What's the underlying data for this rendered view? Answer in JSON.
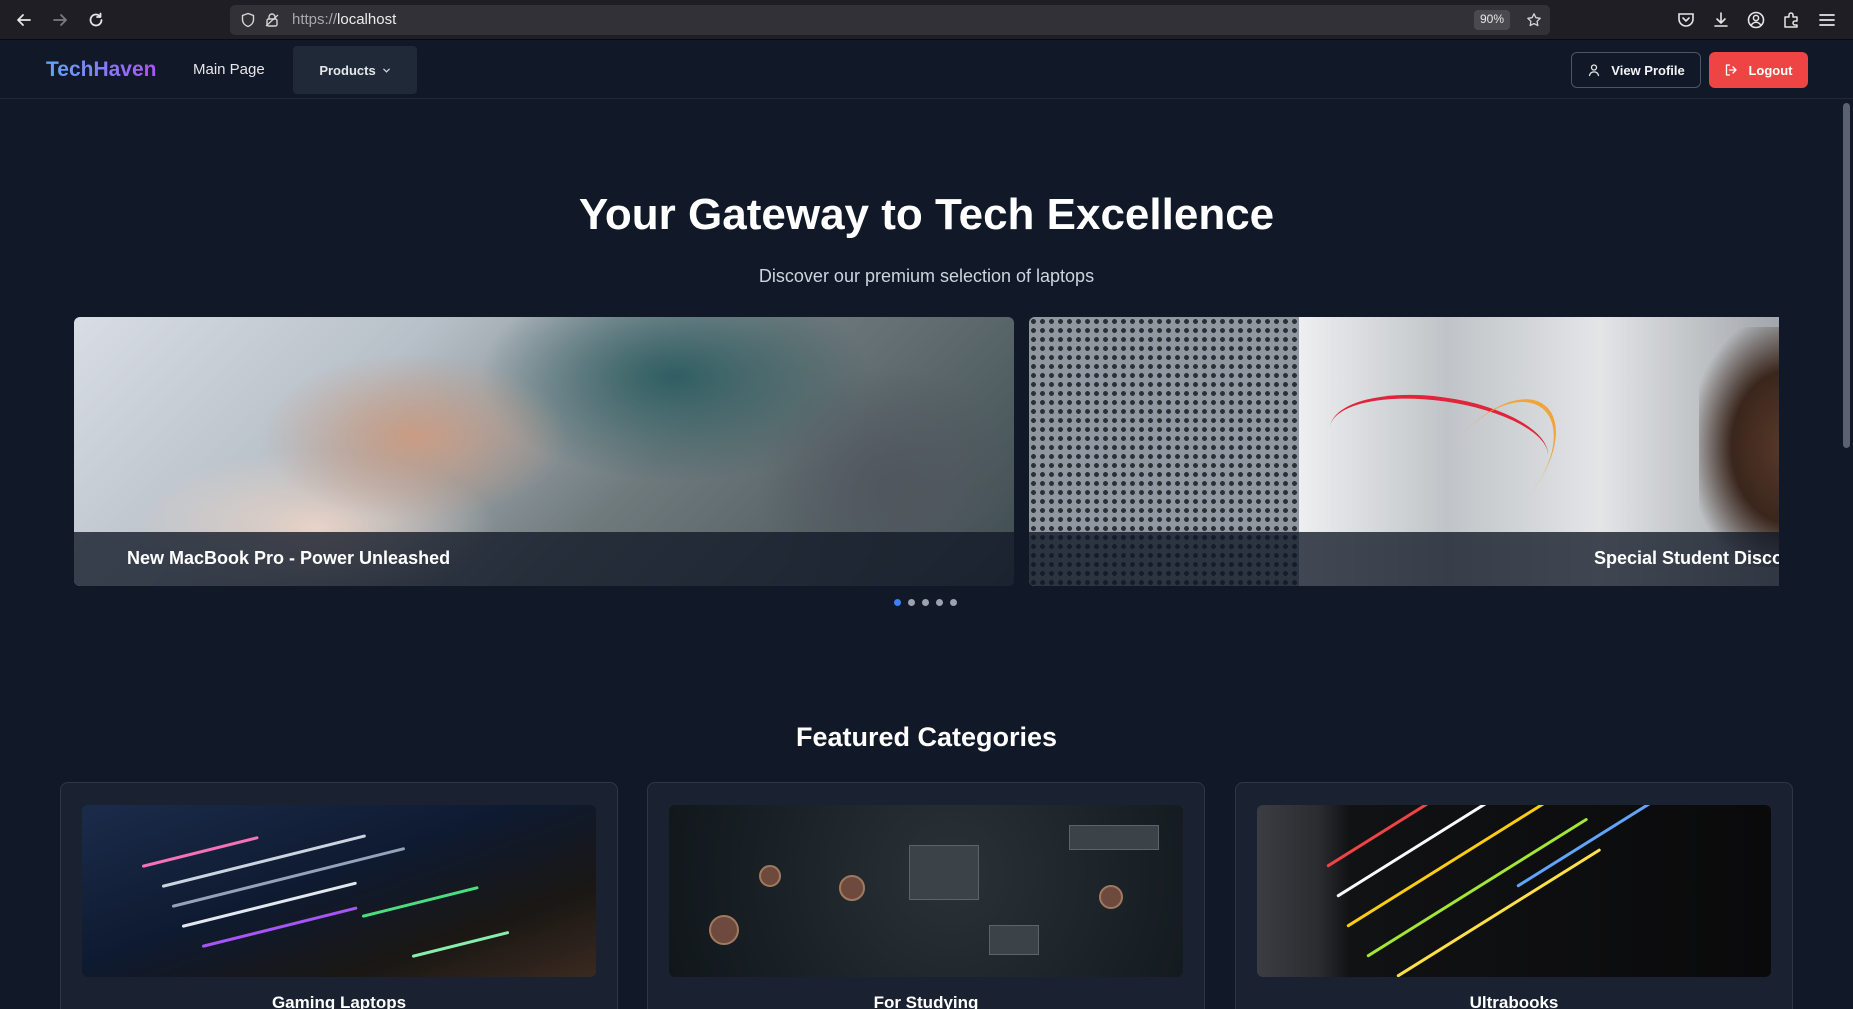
{
  "browser": {
    "url_scheme": "https://",
    "url_host": "localhost",
    "zoom": "90%"
  },
  "nav": {
    "brand": "TechHaven",
    "main_page": "Main Page",
    "products": "Products",
    "view_profile": "View Profile",
    "logout": "Logout"
  },
  "hero": {
    "title": "Your Gateway to Tech Excellence",
    "subtitle": "Discover our premium selection of laptops"
  },
  "carousel": {
    "slides": [
      {
        "caption": "New MacBook Pro - Power Unleashed"
      },
      {
        "caption": "Special Student Disco"
      }
    ],
    "dot_count": 5,
    "active_dot": 0
  },
  "featured": {
    "title": "Featured Categories",
    "categories": [
      {
        "label": "Gaming Laptops"
      },
      {
        "label": "For Studying"
      },
      {
        "label": "Ultrabooks"
      }
    ]
  },
  "colors": {
    "background": "#111827",
    "logout": "#ef4444",
    "active_dot": "#3b82f6"
  }
}
